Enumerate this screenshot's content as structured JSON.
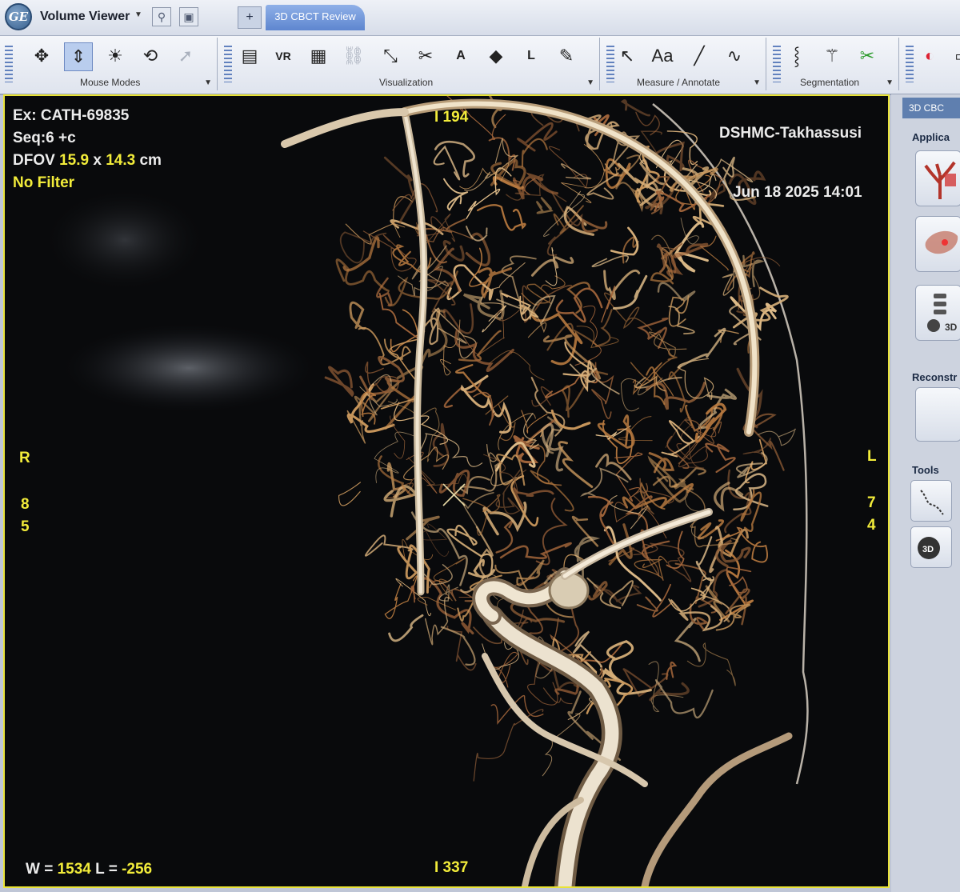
{
  "titlebar": {
    "app_title": "Volume Viewer",
    "tab_plus": "+",
    "active_tab": "3D CBCT Review"
  },
  "toolbar": {
    "groups": [
      {
        "label": "Mouse Modes",
        "tools": [
          "pan-icon",
          "zoom-icon",
          "window-level-icon",
          "rotate-3d-icon",
          "pointer-icon"
        ]
      },
      {
        "label": "Visualization",
        "tools": [
          "layout-icon",
          "vr-icon",
          "screen-icon",
          "link-icon",
          "clip-icon",
          "cut-icon",
          "view-a-icon",
          "view-p-icon",
          "view-l-icon",
          "paint-icon"
        ]
      },
      {
        "label": "Measure / Annotate",
        "tools": [
          "arrow-icon",
          "text-icon",
          "line-icon",
          "curve-icon"
        ]
      },
      {
        "label": "Segmentation",
        "tools": [
          "vessel-track-icon",
          "magic-wand-icon",
          "scissors-icon"
        ]
      }
    ],
    "vr_label": "VR",
    "text_tool_label": "Aa",
    "view_a_label": "A",
    "view_l_label": "L"
  },
  "viewport": {
    "exam": "Ex: CATH-69835",
    "series": "Seq:6 +c",
    "dfov_prefix": "DFOV",
    "dfov_w": "15.9",
    "dfov_x": "x",
    "dfov_h": "14.3",
    "dfov_unit": "cm",
    "filter": "No Filter",
    "institution": "DSHMC-Takhassusi",
    "datetime": "Jun 18 2025 14:01",
    "top_marker": "I 194",
    "bottom_marker": "I 337",
    "left_orient": "R",
    "left_num_1": "8",
    "left_num_2": "5",
    "right_orient": "L",
    "right_num_1": "7",
    "right_num_2": "4",
    "window_label": "W =",
    "window_value": "1534",
    "level_label": "L =",
    "level_value": "-256"
  },
  "right_panel": {
    "tab": "3D CBC",
    "section_apps": "Applica",
    "section_recon": "Reconstr",
    "section_tools": "Tools",
    "btn_3d_label": "3D"
  }
}
